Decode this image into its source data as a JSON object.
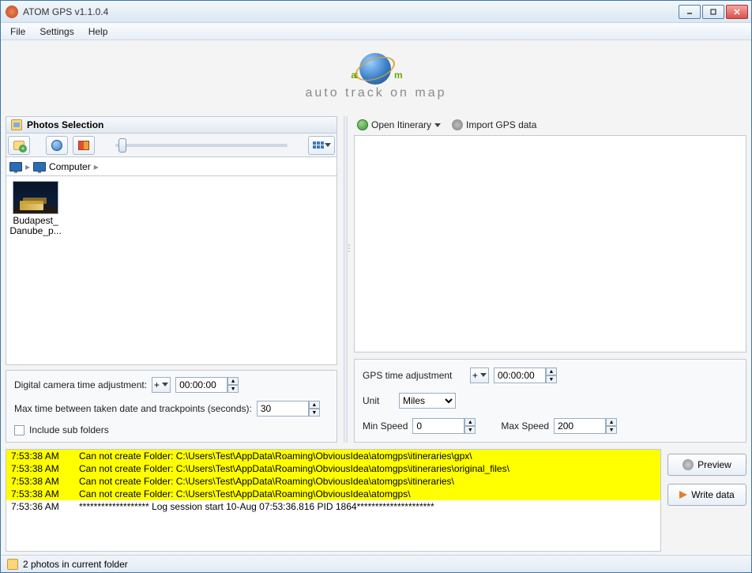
{
  "window": {
    "title": "ATOM GPS v1.1.0.4"
  },
  "menu": {
    "file": "File",
    "settings": "Settings",
    "help": "Help"
  },
  "logo": {
    "text_pre": "at",
    "text_post": "m",
    "tagline": "auto track on map"
  },
  "left": {
    "header": "Photos Selection",
    "breadcrumb": {
      "root_icon": "monitor",
      "item": "Computer"
    },
    "photo": {
      "label_line1": "Budapest_",
      "label_line2": "Danube_p..."
    },
    "form": {
      "cam_adj_label": "Digital camera time adjustment:",
      "cam_adj_sign": "+",
      "cam_adj_value": "00:00:00",
      "maxtime_label": "Max time between taken date and trackpoints (seconds):",
      "maxtime_value": "30",
      "include_sub_label": "Include sub folders"
    }
  },
  "right": {
    "open_itinerary": "Open Itinerary",
    "import_gps": "Import GPS data",
    "form": {
      "gps_adj_label": "GPS time adjustment",
      "gps_adj_sign": "+",
      "gps_adj_value": "00:00:00",
      "unit_label": "Unit",
      "unit_value": "Miles",
      "minspeed_label": "Min Speed",
      "minspeed_value": "0",
      "maxspeed_label": "Max Speed",
      "maxspeed_value": "200"
    }
  },
  "log": [
    {
      "time": "7:53:38 AM",
      "msg": "Can not create Folder: C:\\Users\\Test\\AppData\\Roaming\\ObviousIdea\\atomgps\\itineraries\\gpx\\",
      "warn": true
    },
    {
      "time": "7:53:38 AM",
      "msg": "Can not create Folder: C:\\Users\\Test\\AppData\\Roaming\\ObviousIdea\\atomgps\\itineraries\\original_files\\",
      "warn": true
    },
    {
      "time": "7:53:38 AM",
      "msg": "Can not create Folder: C:\\Users\\Test\\AppData\\Roaming\\ObviousIdea\\atomgps\\itineraries\\",
      "warn": true
    },
    {
      "time": "7:53:38 AM",
      "msg": "Can not create Folder: C:\\Users\\Test\\AppData\\Roaming\\ObviousIdea\\atomgps\\",
      "warn": true
    },
    {
      "time": "7:53:36 AM",
      "msg": "******************* Log session start 10-Aug 07:53:36.816 PID 1864*********************",
      "warn": false
    }
  ],
  "actions": {
    "preview": "Preview",
    "write": "Write data"
  },
  "status": {
    "text": "2 photos in current folder"
  }
}
